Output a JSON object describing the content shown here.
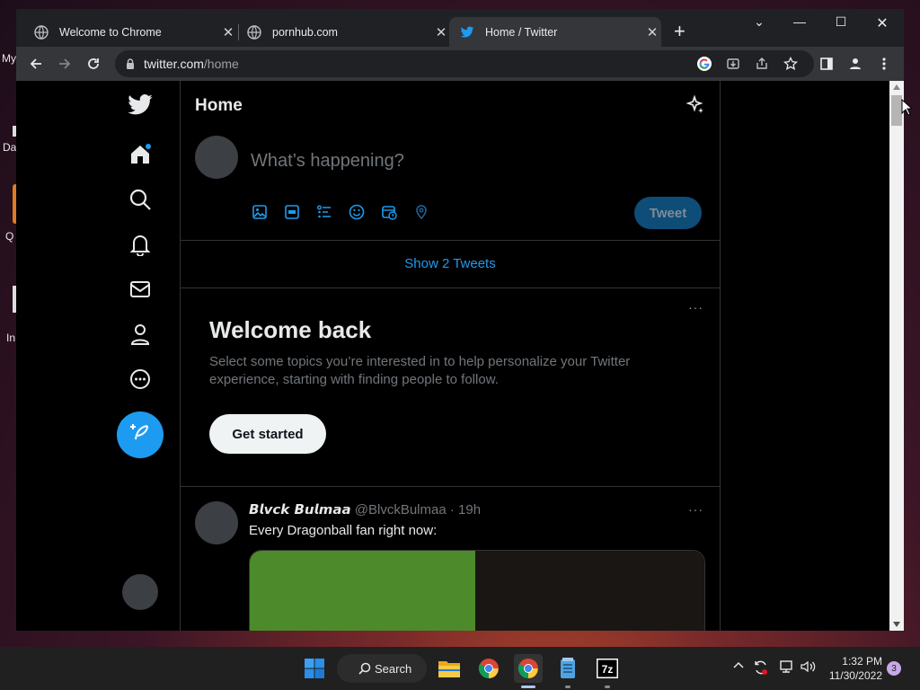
{
  "desktop": {
    "fragments": [
      "My",
      "Da",
      "Q",
      "In"
    ]
  },
  "browser": {
    "tabs": [
      {
        "title": "Welcome to Chrome",
        "icon": "globe-icon",
        "active": false
      },
      {
        "title": "pornhub.com",
        "icon": "globe-icon",
        "active": false
      },
      {
        "title": "Home / Twitter",
        "icon": "twitter-bird-icon",
        "active": true
      }
    ],
    "new_tab_label": "+",
    "url_host": "twitter.com",
    "url_path": "/home"
  },
  "twitter": {
    "header_title": "Home",
    "compose_placeholder": "What’s happening?",
    "tweet_button": "Tweet",
    "show_tweets": "Show 2 Tweets",
    "welcome": {
      "title": "Welcome back",
      "description": "Select some topics you’re interested in to help personalize your Twitter experience, starting with finding people to follow.",
      "button": "Get started"
    },
    "tweet": {
      "author_name": "𝘽𝙡𝙫𝙘𝙠 𝘽𝙪𝙡𝙢𝙖𝙖",
      "handle": "@BlvckBulmaa",
      "time": "19h",
      "text": "Every Dragonball fan right now:"
    },
    "more_label": "···",
    "accent_color": "#1d9bf0"
  },
  "taskbar": {
    "search_label": "Search",
    "time": "1:32 PM",
    "date": "11/30/2022",
    "notification_count": "3"
  }
}
